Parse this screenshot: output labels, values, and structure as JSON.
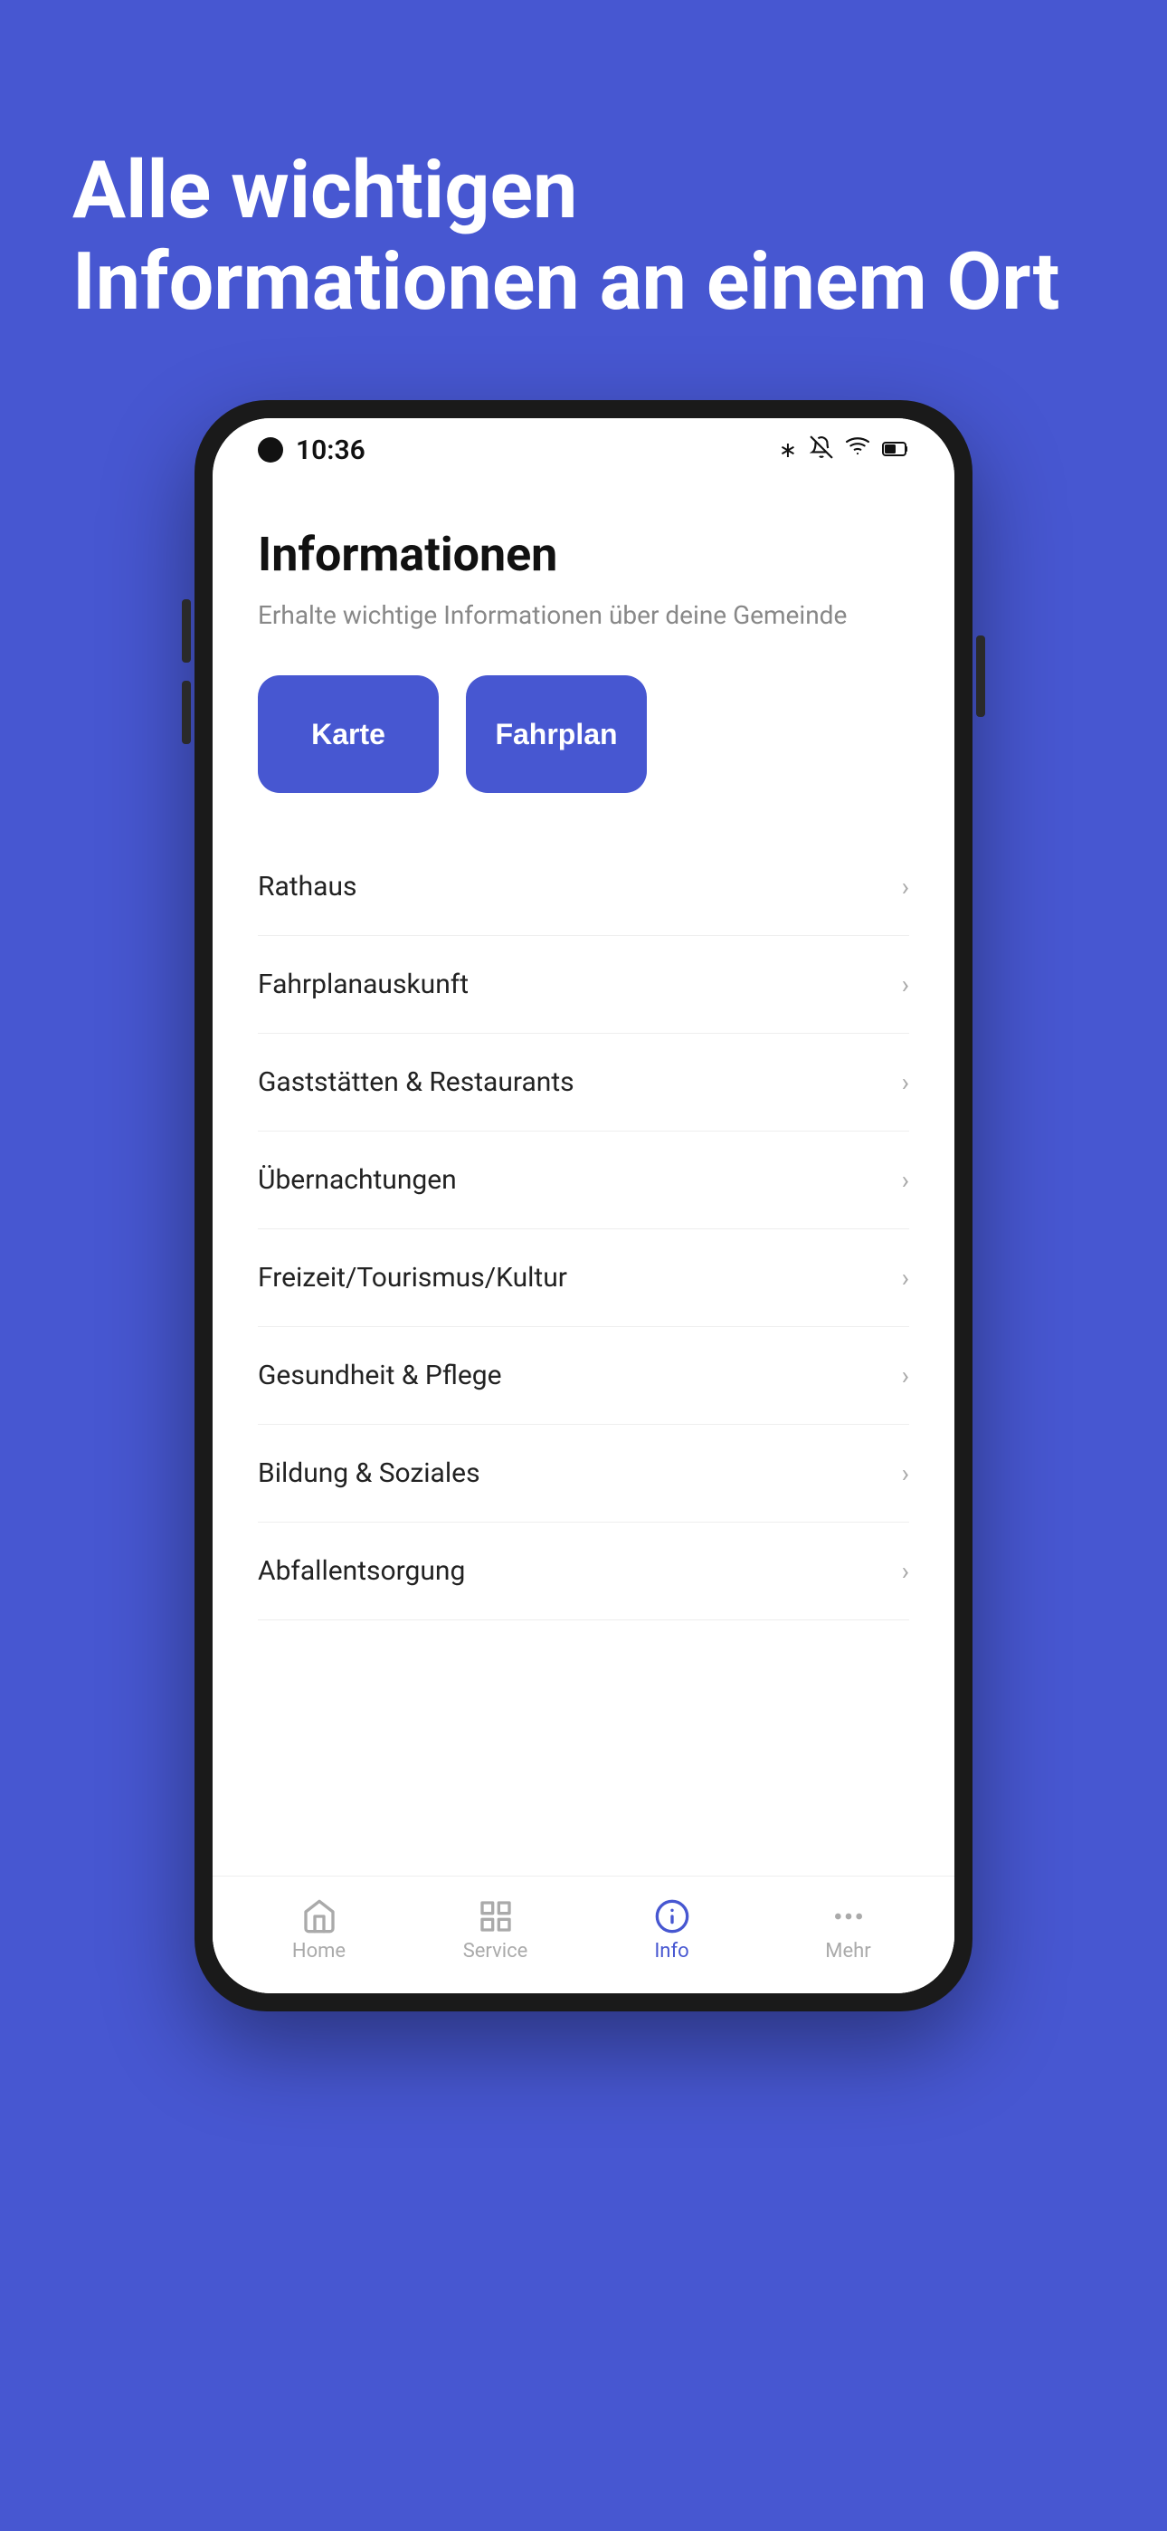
{
  "background_color": "#4757d1",
  "hero": {
    "title": "Alle wichtigen Informationen an einem Ort"
  },
  "phone": {
    "status_bar": {
      "time": "10:36"
    },
    "app": {
      "page_title": "Informationen",
      "page_subtitle": "Erhalte wichtige Informationen über deine Gemeinde",
      "quick_actions": [
        {
          "label": "Karte",
          "id": "karte"
        },
        {
          "label": "Fahrplan",
          "id": "fahrplan"
        }
      ],
      "menu_items": [
        {
          "label": "Rathaus",
          "id": "rathaus"
        },
        {
          "label": "Fahrplanauskunft",
          "id": "fahrplanauskunft"
        },
        {
          "label": "Gaststätten & Restaurants",
          "id": "gaststaetten"
        },
        {
          "label": "Übernachtungen",
          "id": "uebernachtungen"
        },
        {
          "label": "Freizeit/Tourismus/Kultur",
          "id": "freizeit"
        },
        {
          "label": "Gesundheit & Pflege",
          "id": "gesundheit"
        },
        {
          "label": "Bildung & Soziales",
          "id": "bildung"
        },
        {
          "label": "Abfallentsorgung",
          "id": "abfall"
        }
      ]
    },
    "bottom_nav": [
      {
        "label": "Home",
        "id": "home",
        "active": false,
        "icon": "home"
      },
      {
        "label": "Service",
        "id": "service",
        "active": false,
        "icon": "grid"
      },
      {
        "label": "Info",
        "id": "info",
        "active": true,
        "icon": "info"
      },
      {
        "label": "Mehr",
        "id": "mehr",
        "active": false,
        "icon": "dots"
      }
    ]
  }
}
